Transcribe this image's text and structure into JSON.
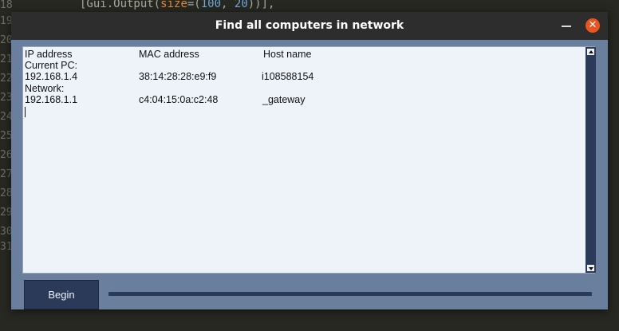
{
  "editor": {
    "code_prefix": "[Gui.Output(",
    "code_kw": "size",
    "code_eq": "=(",
    "code_n1": "100",
    "code_sep": ", ",
    "code_n2": "20",
    "code_suffix": "))],",
    "line_numbers": [
      "18",
      "19",
      "20",
      "21",
      "22",
      "23",
      "24",
      "25",
      "26",
      "27",
      "28",
      "29",
      "30",
      "31"
    ]
  },
  "window": {
    "title": "Find all computers in network",
    "minimize_glyph": "",
    "close_glyph": "✕"
  },
  "output": {
    "headers": {
      "ip": "IP address",
      "mac": "MAC address",
      "host": "Host name"
    },
    "current_label": "Current PC:",
    "current": {
      "ip": "192.168.1.4",
      "mac": "38:14:28:28:e9:f9",
      "host": "i108588154"
    },
    "network_label": "Network:",
    "network": [
      {
        "ip": "192.168.1.1",
        "mac": "c4:04:15:0a:c2:48",
        "host": "_gateway"
      }
    ]
  },
  "controls": {
    "begin_label": "Begin",
    "progress": 0
  },
  "colors": {
    "window_bg": "#6a7f9d",
    "dark_blue": "#2b3a58",
    "text_area_bg": "#eef2f9",
    "close_button": "#e9541f",
    "titlebar": "#2d2d2d"
  }
}
